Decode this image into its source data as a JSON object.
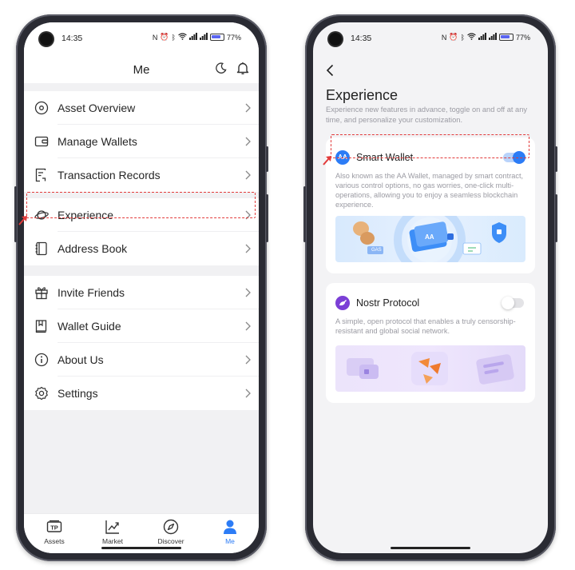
{
  "status": {
    "time": "14:35",
    "battery": "77%"
  },
  "left": {
    "title": "Me",
    "groups": [
      {
        "items": [
          {
            "label": "Asset Overview",
            "icon": "target-icon"
          },
          {
            "label": "Manage Wallets",
            "icon": "wallet-icon"
          },
          {
            "label": "Transaction Records",
            "icon": "records-icon"
          }
        ]
      },
      {
        "items": [
          {
            "label": "Experience",
            "icon": "planet-icon"
          },
          {
            "label": "Address Book",
            "icon": "book-icon"
          }
        ]
      },
      {
        "items": [
          {
            "label": "Invite Friends",
            "icon": "gift-icon"
          },
          {
            "label": "Wallet Guide",
            "icon": "guide-icon"
          },
          {
            "label": "About Us",
            "icon": "info-icon"
          },
          {
            "label": "Settings",
            "icon": "gear-icon"
          }
        ]
      }
    ],
    "tabs": [
      {
        "label": "Assets",
        "icon": "tp-icon",
        "active": false
      },
      {
        "label": "Market",
        "icon": "chart-icon",
        "active": false
      },
      {
        "label": "Discover",
        "icon": "compass-icon",
        "active": false
      },
      {
        "label": "Me",
        "icon": "person-icon",
        "active": true
      }
    ]
  },
  "right": {
    "title": "Experience",
    "description": "Experience new features in advance, toggle on and off at any time, and personalize your customization.",
    "features": [
      {
        "badge": "AA",
        "name": "Smart Wallet",
        "enabled": true,
        "description": "Also known as the AA Wallet, managed by smart contract, various control options, no gas worries, one-click multi-operations, allowing you to enjoy a seamless blockchain experience.",
        "banner_labels": [
          "GAS",
          "AA"
        ]
      },
      {
        "name": "Nostr Protocol",
        "enabled": false,
        "description": "A simple, open protocol that enables a truly censorship-resistant and global social network."
      }
    ]
  },
  "colors": {
    "accent": "#2c7cf6",
    "highlight": "#e23b3b",
    "nostr": "#7b3fd6"
  }
}
